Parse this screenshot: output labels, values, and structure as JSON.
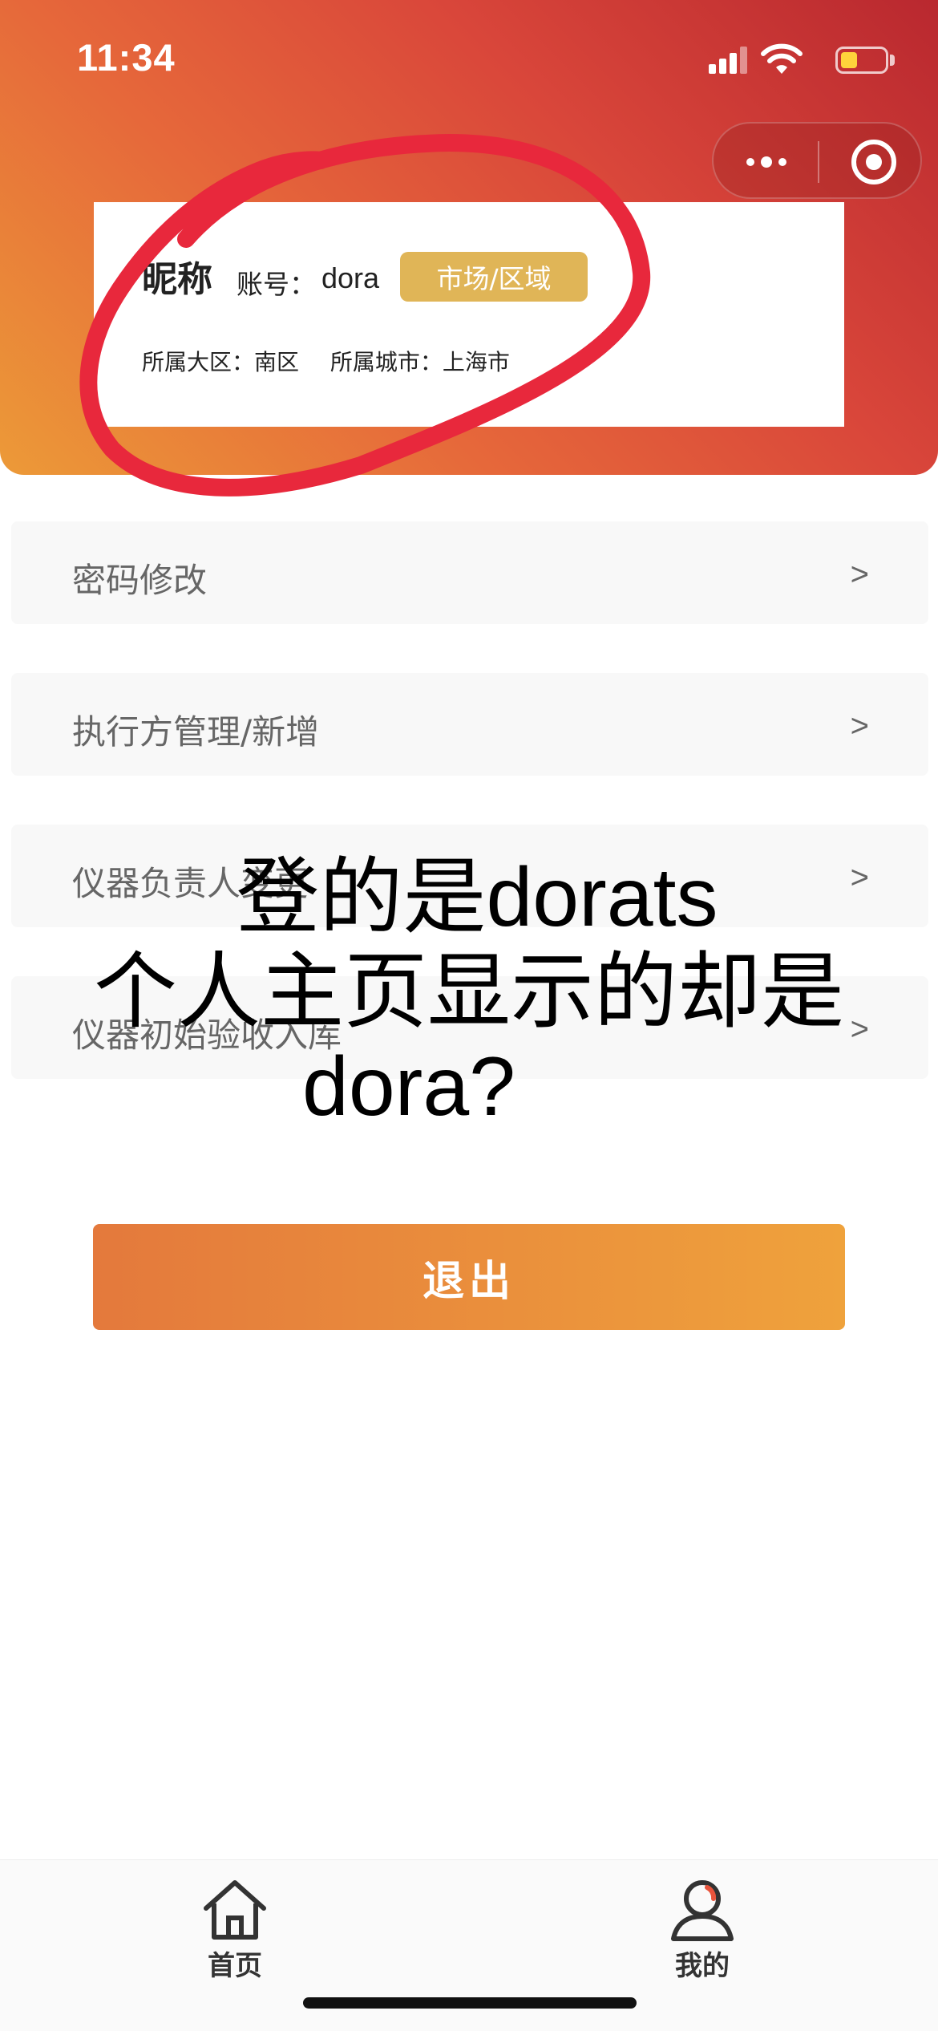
{
  "status_bar": {
    "time": "11:34"
  },
  "capsule": {
    "more_icon": "more-dots-icon",
    "close_icon": "target-circle-icon"
  },
  "profile": {
    "nickname": "昵称",
    "account_label": "账号：",
    "account_value": "dora",
    "role_badge": "市场/区域",
    "region": "所属大区：南区",
    "city": "所属城市：上海市"
  },
  "menu": [
    {
      "label": "密码修改",
      "arrow": ">"
    },
    {
      "label": "执行方管理/新增",
      "arrow": ">"
    },
    {
      "label": "仪器负责人变更",
      "arrow": ">"
    },
    {
      "label": "仪器初始验收入库",
      "arrow": ">"
    }
  ],
  "logout_label": "退出",
  "overlay": {
    "line1": "登的是dorats",
    "line2": "个人主页显示的却是",
    "line3": "dora?"
  },
  "tabs": [
    {
      "label": "首页",
      "icon": "home-icon"
    },
    {
      "label": "我的",
      "icon": "user-icon"
    }
  ],
  "colors": {
    "header_gradient_start": "#b9282f",
    "header_gradient_end": "#ec9a38",
    "badge": "#e0b557",
    "button_start": "#e4793c",
    "button_end": "#efa23c",
    "annotation_red": "#e8283c"
  }
}
